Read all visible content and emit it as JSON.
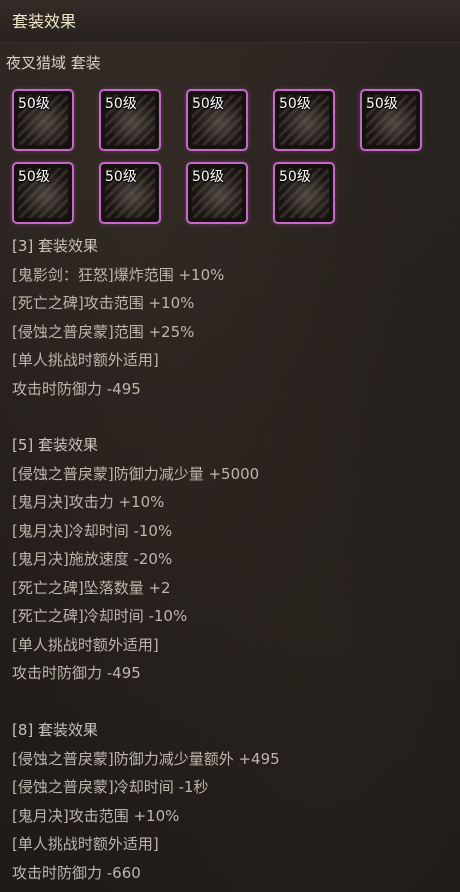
{
  "title": "套装效果",
  "set_name": "夜叉猎域  套装",
  "items": [
    {
      "level": "50级"
    },
    {
      "level": "50级"
    },
    {
      "level": "50级"
    },
    {
      "level": "50级"
    },
    {
      "level": "50级"
    },
    {
      "level": "50级"
    },
    {
      "level": "50级"
    },
    {
      "level": "50级"
    },
    {
      "level": "50级"
    }
  ],
  "sections": [
    {
      "lines": [
        "[3] 套装效果",
        "[鬼影剑：狂怒]爆炸范围 +10%",
        "[死亡之碑]攻击范围 +10%",
        "[侵蚀之普戾蒙]范围 +25%",
        "[单人挑战时额外适用]",
        "攻击时防御力 -495"
      ]
    },
    {
      "lines": [
        "[5] 套装效果",
        "[侵蚀之普戾蒙]防御力减少量 +5000",
        "[鬼月决]攻击力 +10%",
        "[鬼月决]冷却时间 -10%",
        "[鬼月决]施放速度 -20%",
        "[死亡之碑]坠落数量 +2",
        "[死亡之碑]冷却时间 -10%",
        "[单人挑战时额外适用]",
        "攻击时防御力 -495"
      ]
    },
    {
      "lines": [
        "[8] 套装效果",
        "[侵蚀之普戾蒙]防御力减少量额外 +495",
        "[侵蚀之普戾蒙]冷却时间 -1秒",
        "[鬼月决]攻击范围 +10%",
        "[单人挑战时额外适用]",
        "攻击时防御力 -660"
      ]
    }
  ]
}
